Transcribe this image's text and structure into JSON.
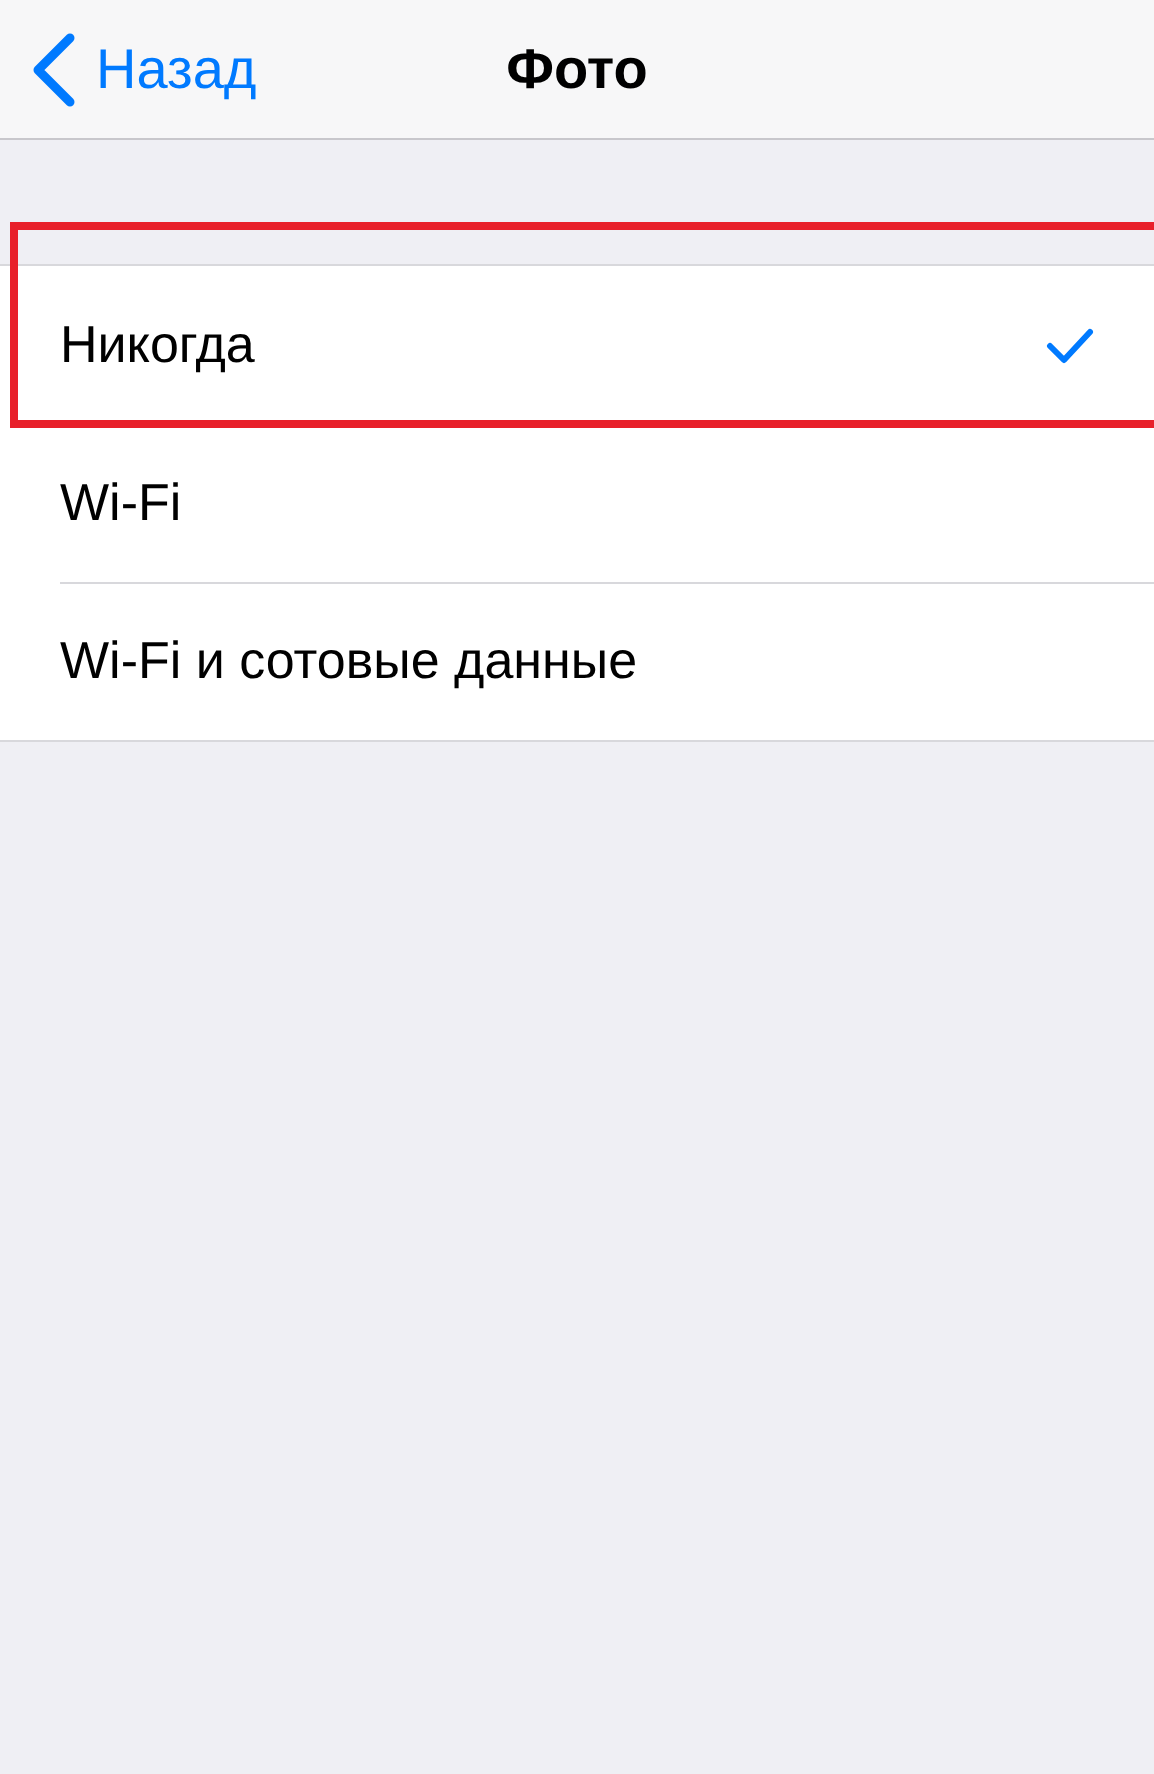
{
  "nav_bar": {
    "back": "Назад",
    "title": "Фото"
  },
  "options": [
    {
      "label": "Никогда",
      "selected": true,
      "highlighted": true
    },
    {
      "label": "Wi-Fi",
      "selected": false,
      "highlighted": false
    },
    {
      "label": "Wi-Fi и сотовые данные",
      "selected": false,
      "highlighted": false
    }
  ]
}
